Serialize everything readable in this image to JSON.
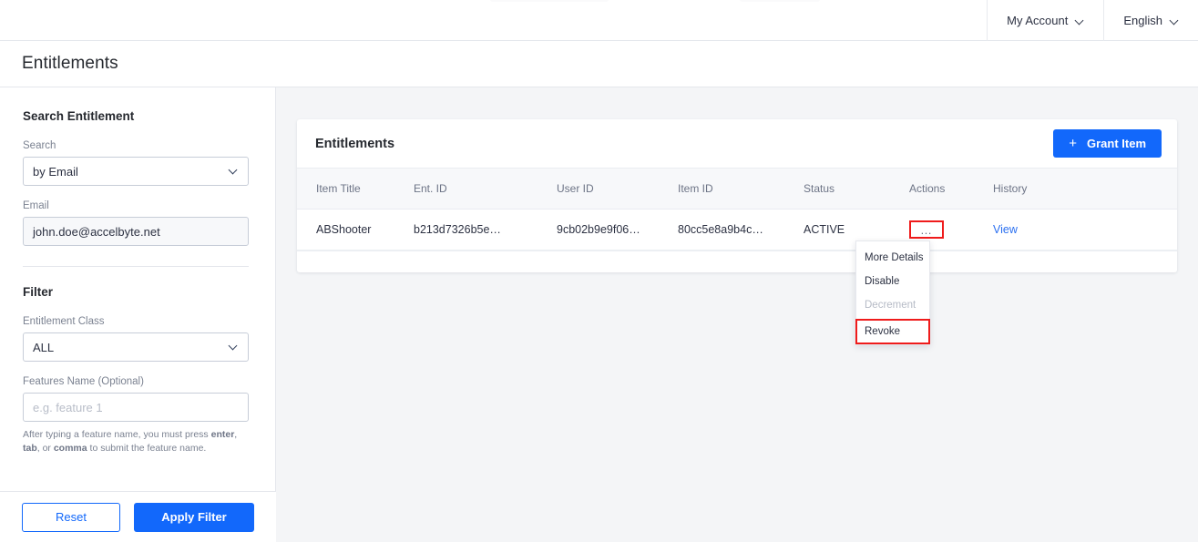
{
  "topbar": {
    "account_label": "My Account",
    "language_label": "English"
  },
  "page": {
    "title": "Entitlements"
  },
  "sidebar": {
    "search_section": {
      "heading": "Search Entitlement",
      "search_label": "Search",
      "search_select_value": "by Email",
      "email_label": "Email",
      "email_value": "john.doe@accelbyte.net"
    },
    "filter_section": {
      "heading": "Filter",
      "entitlement_class_label": "Entitlement Class",
      "entitlement_class_value": "ALL",
      "features_label": "Features Name (Optional)",
      "features_placeholder": "e.g. feature 1",
      "helper_prefix": "After typing a feature name, you must press ",
      "helper_key1": "enter",
      "helper_sep1": ", ",
      "helper_key2": "tab",
      "helper_sep2": ", or ",
      "helper_key3": "comma",
      "helper_suffix": " to submit the feature name."
    },
    "footer": {
      "reset_label": "Reset",
      "apply_label": "Apply Filter"
    }
  },
  "main": {
    "card_title": "Entitlements",
    "grant_button": {
      "icon": "plus-icon",
      "label": "Grant Item"
    },
    "table": {
      "columns": [
        "Item Title",
        "Ent. ID",
        "User ID",
        "Item ID",
        "Status",
        "Actions",
        "History"
      ],
      "rows": [
        {
          "item_title": "ABShooter",
          "ent_id": "b213d7326b5e…",
          "user_id": "9cb02b9e9f06…",
          "item_id": "80cc5e8a9b4c…",
          "status": "ACTIVE",
          "actions": "…",
          "history": "View"
        }
      ]
    },
    "actions_menu": {
      "items": [
        {
          "label": "More Details",
          "state": "enabled"
        },
        {
          "label": "Disable",
          "state": "enabled"
        },
        {
          "label": "Decrement",
          "state": "disabled"
        },
        {
          "label": "Revoke",
          "state": "highlighted"
        }
      ]
    }
  },
  "colors": {
    "accent_blue": "#1268fb",
    "link_blue": "#2a6ff0",
    "highlight_red": "#ef1b1b",
    "canvas_grey": "#f4f5f7",
    "table_head_grey": "#f7f8fa"
  }
}
